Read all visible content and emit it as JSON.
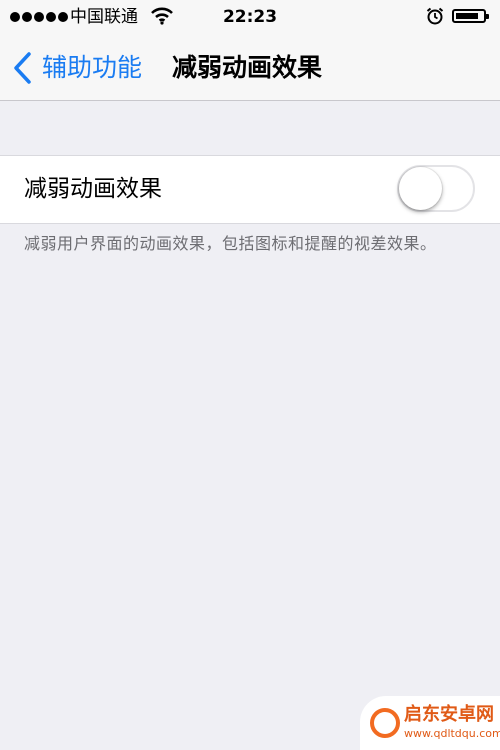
{
  "status_bar": {
    "carrier": "中国联通",
    "time": "22:23",
    "icons": [
      "signal-dots-icon",
      "wifi-icon",
      "alarm-icon",
      "battery-icon"
    ]
  },
  "nav": {
    "back_label": "辅助功能",
    "title": "减弱动画效果"
  },
  "setting": {
    "label": "减弱动画效果",
    "toggle_on": false
  },
  "footer_note": "减弱用户界面的动画效果，包括图标和提醒的视差效果。",
  "watermark": {
    "title": "启东安卓网",
    "url": "www.qdltdqu.com"
  },
  "colors": {
    "accent": "#1a7cf2",
    "background": "#efeff4",
    "watermark": "#e05a16"
  }
}
